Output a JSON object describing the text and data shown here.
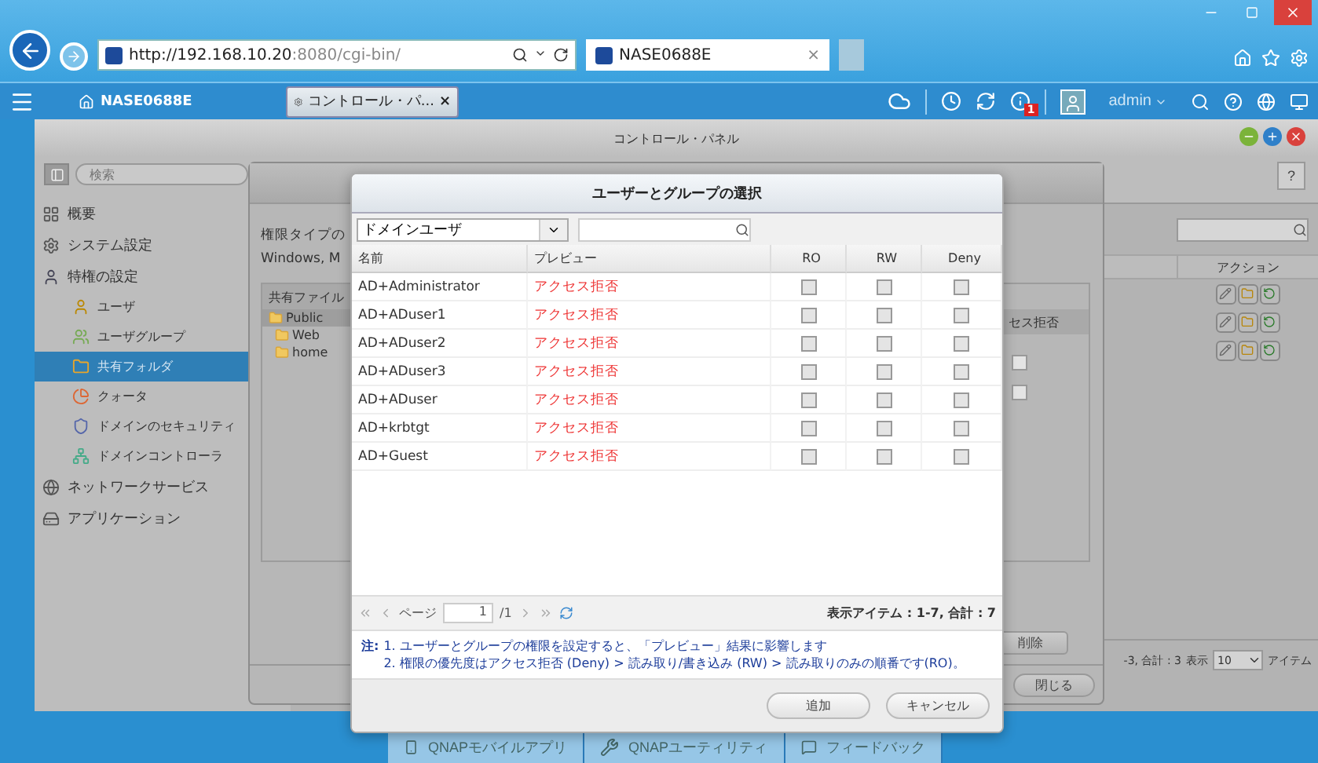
{
  "browser": {
    "address_host": "http://192.168.10.20",
    "address_rest": ":8080/cgi-bin/",
    "tab": "NASE0688E",
    "tab_close": "×"
  },
  "app_bar": {
    "home": "NASE0688E",
    "tab": "コントロール・パ...",
    "tab_close": "×",
    "user": "admin",
    "notification_count": "1"
  },
  "control_panel": {
    "title": "コントロール・パネル",
    "search": {
      "placeholder": "検索"
    },
    "help": "?",
    "sidebar": [
      {
        "label": "概要",
        "selected": false
      },
      {
        "label": "システム設定",
        "selected": false
      },
      {
        "label": "特権の設定",
        "selected": false,
        "children": [
          {
            "label": "ユーザ",
            "selected": false
          },
          {
            "label": "ユーザグループ",
            "selected": false
          },
          {
            "label": "共有フォルダ",
            "selected": true
          },
          {
            "label": "クォータ",
            "selected": false
          },
          {
            "label": "ドメインのセキュリティ",
            "selected": false
          },
          {
            "label": "ドメインコントローラ",
            "selected": false
          }
        ]
      },
      {
        "label": "ネットワークサービス",
        "selected": false
      },
      {
        "label": "アプリケーション",
        "selected": false
      }
    ],
    "table": {
      "action_header": "アクション",
      "pager": "-3, 合計 : 3",
      "show_label": "表示",
      "page_size": "10",
      "items_label": "アイテム"
    }
  },
  "folder_dialog": {
    "intro_1": "権限タイプの",
    "intro_2": "Windows, M",
    "tree_header": "共有ファイル",
    "folders": [
      {
        "name": "Public",
        "selected": true
      },
      {
        "name": "Web",
        "selected": false
      },
      {
        "name": "home",
        "selected": false
      }
    ],
    "deny_header": "セス拒否",
    "deny_checks": [
      {
        "checked": false
      },
      {
        "checked": false
      }
    ],
    "delete": "削除",
    "close": "閉じる"
  },
  "modal": {
    "title": "ユーザーとグループの選択",
    "filter": "ドメインユーザ",
    "columns": [
      "名前",
      "プレビュー",
      "RO",
      "RW",
      "Deny"
    ],
    "rows": [
      {
        "name": "AD+Administrator",
        "preview": "アクセス拒否",
        "ro": false,
        "rw": false,
        "deny": false
      },
      {
        "name": "AD+ADuser1",
        "preview": "アクセス拒否",
        "ro": false,
        "rw": false,
        "deny": false
      },
      {
        "name": "AD+ADuser2",
        "preview": "アクセス拒否",
        "ro": false,
        "rw": false,
        "deny": false
      },
      {
        "name": "AD+ADuser3",
        "preview": "アクセス拒否",
        "ro": false,
        "rw": false,
        "deny": false
      },
      {
        "name": "AD+ADuser",
        "preview": "アクセス拒否",
        "ro": false,
        "rw": false,
        "deny": false
      },
      {
        "name": "AD+krbtgt",
        "preview": "アクセス拒否",
        "ro": false,
        "rw": false,
        "deny": false
      },
      {
        "name": "AD+Guest",
        "preview": "アクセス拒否",
        "ro": false,
        "rw": false,
        "deny": false
      }
    ],
    "page_label": "ページ",
    "page": "1",
    "page_total": "/1",
    "summary": "表示アイテム : 1-7, 合計 : 7",
    "note_label": "注:",
    "notes": [
      "1. ユーザーとグループの権限を設定すると、「プレビュー」結果に影響します",
      "2. 権限の優先度はアクセス拒否 (Deny) > 読み取り/書き込み (RW) > 読み取りのみの順番です(RO)。"
    ],
    "buttons": [
      "追加",
      "キャンセル"
    ]
  },
  "dock": [
    "QNAPモバイルアプリ",
    "QNAPユーティリティ",
    "フィードバック"
  ]
}
